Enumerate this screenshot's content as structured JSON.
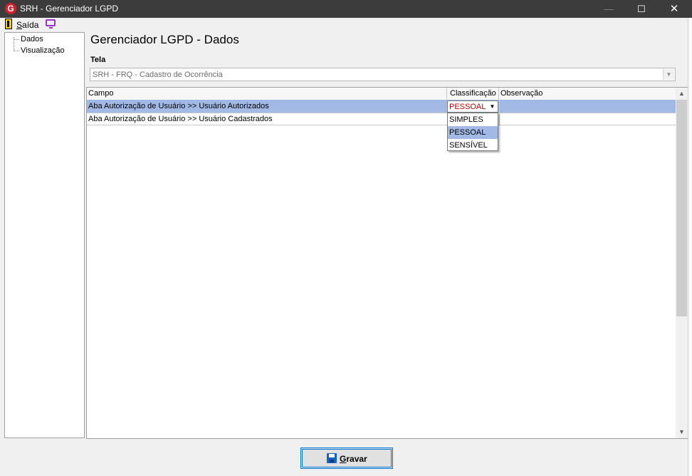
{
  "window": {
    "title": "SRH - Gerenciador LGPD",
    "app_icon": "G",
    "minimize_glyph": "—",
    "maximize_glyph": "☐",
    "close_glyph": "✕"
  },
  "menu": {
    "exit_icon": "exit-door-icon",
    "saida_first": "S",
    "saida_rest": "aída",
    "display_icon": "monitor-icon"
  },
  "sidebar": {
    "items": [
      {
        "label": "Dados"
      },
      {
        "label": "Visualização"
      }
    ]
  },
  "main": {
    "title": "Gerenciador LGPD - Dados",
    "tela_label": "Tela",
    "tela_value": "SRH - FRQ - Cadastro de Ocorrência"
  },
  "grid": {
    "columns": [
      "Campo",
      "Classificação",
      "Observação"
    ],
    "rows": [
      {
        "campo": "Aba Autorização de Usuário >> Usuário Autorizados",
        "classificacao": "PESSOAL",
        "observacao": "",
        "selected": true
      },
      {
        "campo": "Aba Autorização de Usuário >> Usuário Cadastrados",
        "classificacao": "",
        "observacao": "",
        "selected": false
      }
    ],
    "editor_value": "PESSOAL",
    "dropdown_options": [
      "SIMPLES",
      "PESSOAL",
      "SENSÍVEL"
    ],
    "dropdown_highlight": "PESSOAL"
  },
  "footer": {
    "save_first": "G",
    "save_rest": "ravar",
    "save_icon": "floppy-disk-icon"
  },
  "colors": {
    "titlebar": "#3c3c3c",
    "selection": "#a2b9e6",
    "editor_text": "#c00000",
    "button_border": "#0078d7"
  }
}
